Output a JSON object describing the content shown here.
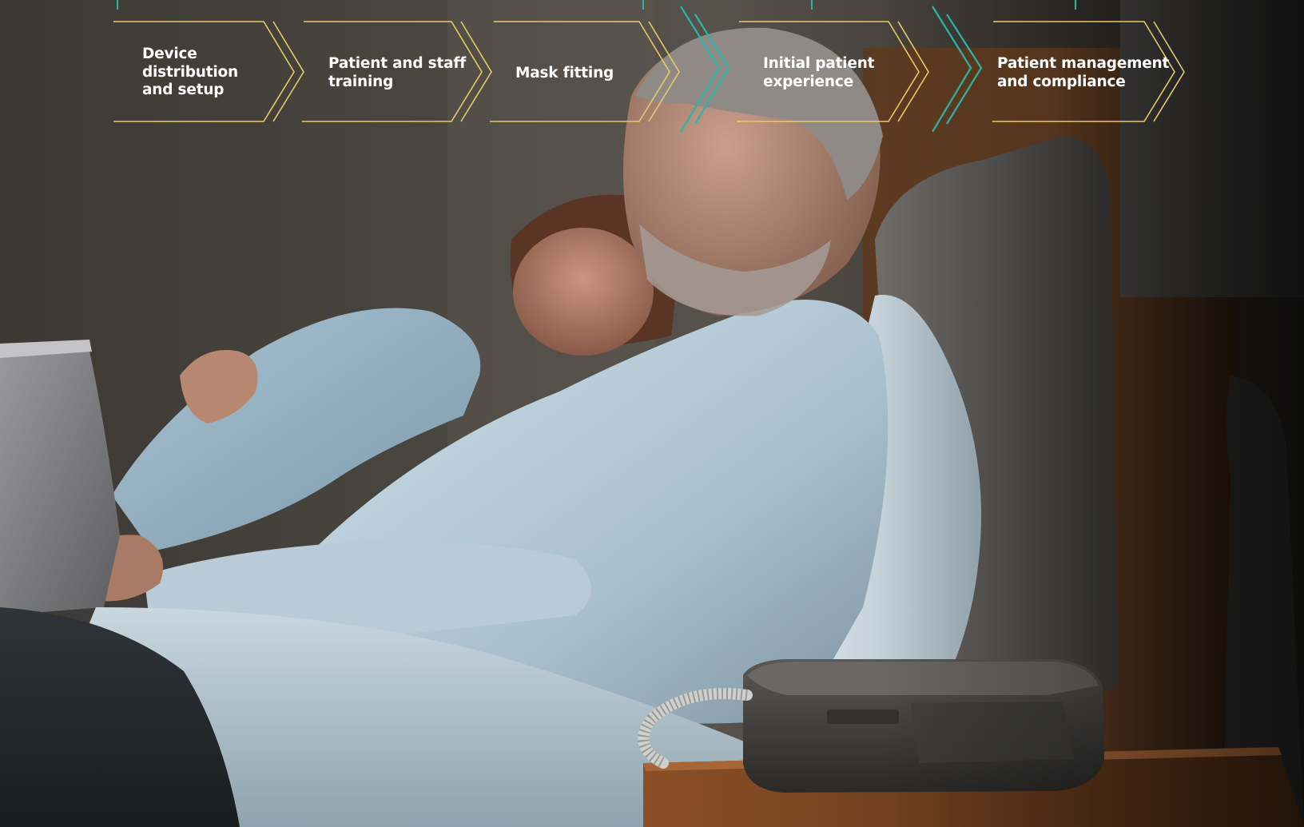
{
  "steps": [
    {
      "lines": [
        "Device",
        "distribution",
        "and setup"
      ],
      "accent": "#e9c86a"
    },
    {
      "lines": [
        "Patient and staff",
        "training"
      ],
      "accent": "#e9c86a"
    },
    {
      "lines": [
        "Mask fitting"
      ],
      "accent": "#e9c86a"
    },
    {
      "lines": [
        "Initial patient",
        "experience"
      ],
      "accent": "#e9c86a"
    },
    {
      "lines": [
        "Patient management",
        "and compliance"
      ],
      "accent": "#e9c86a"
    }
  ],
  "colors": {
    "step_outline": "#e9c86a",
    "separator_chevron": "#2bb5a7",
    "text": "#ffffff"
  },
  "icons": {
    "separator": "double-chevron-right-icon"
  }
}
